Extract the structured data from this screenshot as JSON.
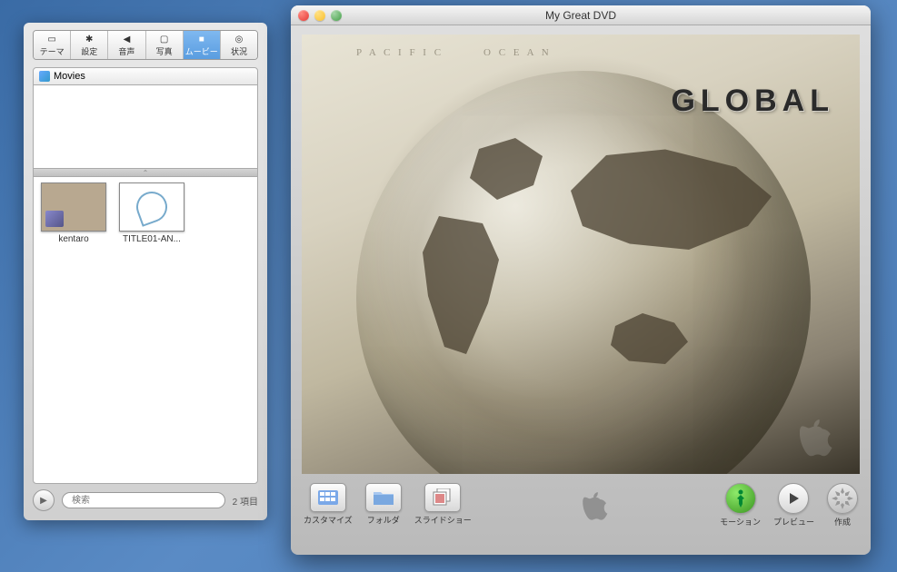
{
  "leftPanel": {
    "tabs": [
      {
        "label": "テーマ",
        "icon": "film"
      },
      {
        "label": "設定",
        "icon": "gear"
      },
      {
        "label": "音声",
        "icon": "speaker"
      },
      {
        "label": "写真",
        "icon": "photo"
      },
      {
        "label": "ムービー",
        "icon": "camera",
        "active": true
      },
      {
        "label": "状況",
        "icon": "target"
      }
    ],
    "sourceHeader": "Movies",
    "thumbs": [
      {
        "label": "kentaro",
        "kind": "movie"
      },
      {
        "label": "TITLE01-AN...",
        "kind": "title"
      }
    ],
    "searchPlaceholder": "検索",
    "countLabel": "2 項目"
  },
  "mainWindow": {
    "title": "My Great DVD",
    "canvasTitle": "GLOBAL",
    "mapLabels": {
      "pacific": "P A C I F I C",
      "ocean": "O C E A N"
    },
    "toolbar": {
      "customize": "カスタマイズ",
      "folder": "フォルダ",
      "slideshow": "スライドショー",
      "motion": "モーション",
      "preview": "プレビュー",
      "burn": "作成"
    }
  }
}
